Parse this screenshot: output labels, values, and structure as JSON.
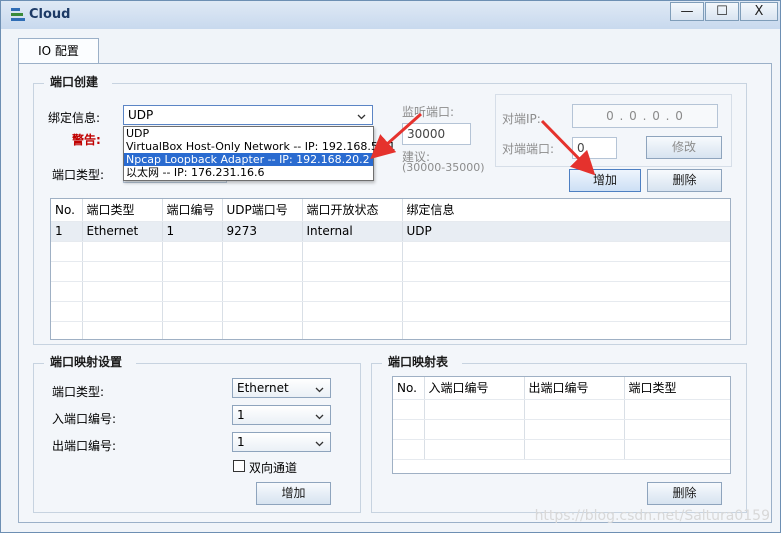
{
  "window": {
    "title": "Cloud",
    "controls": {
      "minimize": "—",
      "maximize": "☐",
      "close": "X"
    }
  },
  "tabs": [
    {
      "label": "IO 配置",
      "active": true
    }
  ],
  "port_create": {
    "title": "端口创建",
    "bind_label": "绑定信息:",
    "bind_value": "UDP",
    "bind_options": [
      "UDP",
      "VirtualBox Host-Only Network -- IP: 192.168.56.1",
      "Npcap Loopback Adapter -- IP: 192.168.20.2",
      "以太网 -- IP: 176.231.16.6"
    ],
    "bind_highlighted_index": 2,
    "warning_label": "警告:",
    "port_type_label": "端口类型:",
    "listen_port_label": "监听端口:",
    "listen_port_value": "30000",
    "suggest_label": "建议:",
    "suggest_range": "(30000-35000)",
    "peer_ip_label": "对端IP:",
    "peer_ip_value": "0 . 0 . 0 . 0",
    "peer_port_label": "对端端口:",
    "peer_port_value": "0",
    "modify_button": "修改",
    "add_button": "增加",
    "delete_button": "删除",
    "table": {
      "columns": [
        "No.",
        "端口类型",
        "端口编号",
        "UDP端口号",
        "端口开放状态",
        "绑定信息"
      ],
      "rows": [
        [
          "1",
          "Ethernet",
          "1",
          "9273",
          "Internal",
          "UDP"
        ]
      ]
    }
  },
  "port_mapping_settings": {
    "title": "端口映射设置",
    "port_type_label": "端口类型:",
    "port_type_value": "Ethernet",
    "in_port_label": "入端口编号:",
    "in_port_value": "1",
    "out_port_label": "出端口编号:",
    "out_port_value": "1",
    "bidirectional_label": "双向通道",
    "bidirectional_checked": false,
    "add_button": "增加"
  },
  "port_mapping_table": {
    "title": "端口映射表",
    "columns": [
      "No.",
      "入端口编号",
      "出端口编号",
      "端口类型"
    ],
    "delete_button": "删除"
  },
  "watermark": "https://blog.csdn.net/Saltura0159",
  "colors": {
    "accent": "#2a6bd0",
    "arrow": "#e5322d",
    "warning": "#c00000"
  }
}
